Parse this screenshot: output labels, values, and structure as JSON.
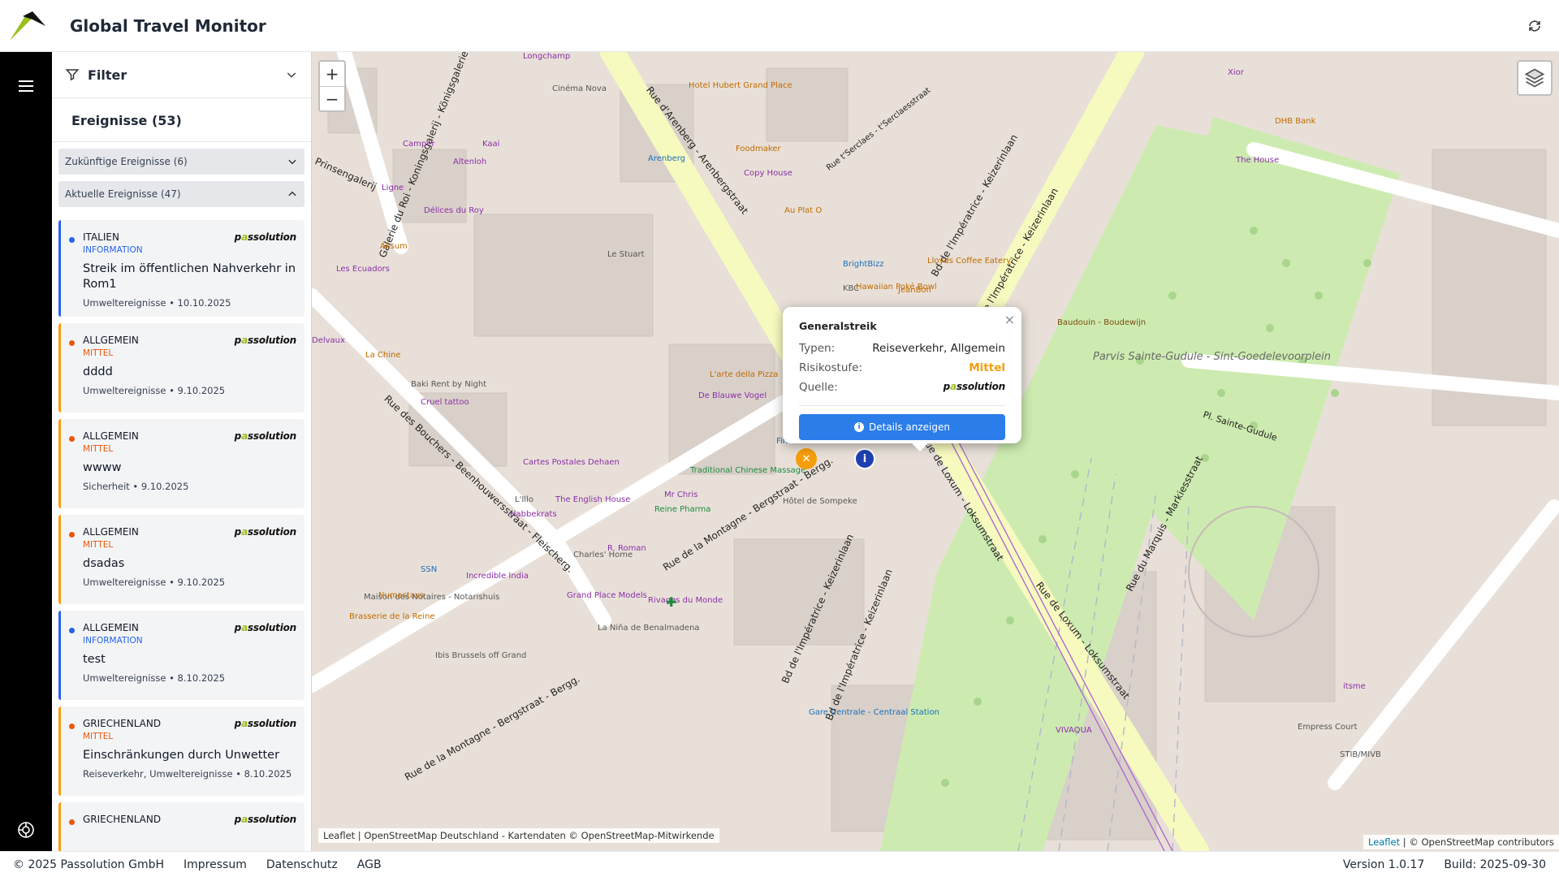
{
  "app": {
    "title": "Global Travel Monitor"
  },
  "sidebar": {
    "filter_label": "Filter",
    "events_title": "Ereignisse (53)",
    "groups": [
      {
        "label": "Zukünftige Ereignisse (6)",
        "expanded": false
      },
      {
        "label": "Aktuelle Ereignisse (47)",
        "expanded": true
      }
    ],
    "cards": [
      {
        "country": "ITALIEN",
        "level": "INFORMATION",
        "level_color": "#2563eb",
        "title": "Streik im öffentlichen Nahverkehr in Rom1",
        "meta": "Umweltereignisse • 10.10.2025",
        "bar_color": "#2563eb"
      },
      {
        "country": "ALLGEMEIN",
        "level": "MITTEL",
        "level_color": "#ea580c",
        "title": "dddd",
        "meta": "Umweltereignisse • 9.10.2025",
        "bar_color": "#f59e0b"
      },
      {
        "country": "ALLGEMEIN",
        "level": "MITTEL",
        "level_color": "#ea580c",
        "title": "wwww",
        "meta": "Sicherheit • 9.10.2025",
        "bar_color": "#f59e0b"
      },
      {
        "country": "ALLGEMEIN",
        "level": "MITTEL",
        "level_color": "#ea580c",
        "title": "dsadas",
        "meta": "Umweltereignisse • 9.10.2025",
        "bar_color": "#f59e0b"
      },
      {
        "country": "ALLGEMEIN",
        "level": "INFORMATION",
        "level_color": "#2563eb",
        "title": "test",
        "meta": "Umweltereignisse • 8.10.2025",
        "bar_color": "#2563eb"
      },
      {
        "country": "GRIECHENLAND",
        "level": "MITTEL",
        "level_color": "#ea580c",
        "title": "Einschränkungen durch Unwetter",
        "meta": "Reiseverkehr, Umweltereignisse • 8.10.2025",
        "bar_color": "#f59e0b"
      },
      {
        "country": "GRIECHENLAND",
        "level": "",
        "level_color": "#ea580c",
        "title": "",
        "meta": "",
        "bar_color": "#f59e0b"
      }
    ],
    "brand": {
      "prefix": "p",
      "accent": "a",
      "suffix": "ssolution"
    }
  },
  "map": {
    "zoom_in": "+",
    "zoom_out": "−",
    "attribution_left": "Leaflet | OpenStreetMap Deutschland - Kartendaten © OpenStreetMap-Mitwirkende",
    "attribution_right_link": "Leaflet",
    "attribution_right_text": " | © OpenStreetMap contributors",
    "labels": {
      "rue_arenberg": "Rue d'Arenberg - Arenbergstraat",
      "bd_imperatrice1": "Bd de l'Impératrice - Keizerinlaan",
      "bd_imperatrice2": "Bd de l'Impératrice - Keizerinlaan",
      "bd_imperatrice3": "Bd de l'Impératrice - Keizerinlaan",
      "bd_imperatrice4": "Bd de l'Impératrice - Keizerinlaan",
      "rue_montagne1": "Rue de la Montagne - Bergstraat - Bergg.",
      "rue_montagne2": "Rue de la Montagne - Bergstraat - Bergg.",
      "rue_bouchers": "Rue des Bouchers - Beenhouwersstraat - Fleischerg.",
      "rue_loxum1": "Rue de Loxum - Loksumstraat",
      "rue_loxum2": "Rue de Loxum - Loksumstraat",
      "rue_marquis": "Rue du Marquis - Markiesstraat",
      "galerie_roi": "Galerie du Roi - Koningsgalerij - Königsgalerie",
      "rue_sserclaes": "Rue t'Serclaes - t'Serclaesstraat",
      "parvis": "Parvis Sainte-Gudule - Sint-Goedelevoorplein",
      "le_stuart": "Le Stuart",
      "hotel_sompeke": "Hôtel de Sompeke",
      "maison_notaires": "Maison des Notaires - Notarishuis",
      "charles_home": "Charles' Home",
      "empress_court": "Empress Court",
      "cinema_nova": "Cinéma Nova",
      "hotel_hubert": "Hotel Hubert Grand Place",
      "foodmaker": "Foodmaker",
      "copy_house": "Copy House",
      "au_plat_o": "Au Plat O",
      "brightbizz": "BrightBizz",
      "kbc": "KBC",
      "hawaiian": "Hawaiian Poké Bowl",
      "jeanbon": "JeanBon",
      "lloyds": "Lloyds Coffee Eatery",
      "the_house": "The House",
      "dhb_bank": "DHB Bank",
      "xior": "Xior",
      "baudouin": "Baudouin - Boudewijn",
      "pl_sainte_gudule": "Pl. Sainte-Gudule",
      "arenberg": "Arenberg",
      "camper": "Camper",
      "kaai": "Kaai",
      "altenloh": "Altenloh",
      "ligne": "Ligne",
      "delices": "Délices du Roy",
      "aksum": "Aksum",
      "les_ecuadors": "Les Ecuadors",
      "delvaux": "Delvaux",
      "la_chine": "La Chine",
      "baki": "Baki Rent by Night",
      "cruel_tattoo": "Cruel tattoo",
      "cartes_postales": "Cartes Postales Dehaen",
      "english_house": "The English House",
      "lillo": "L'Illo",
      "habbekrats": "Habbekrats",
      "reine_pharma": "Reine Pharma",
      "mr_chris": "Mr Chris",
      "traditional": "Traditional Chinese Massage",
      "de_blauwe": "De Blauwe Vogel",
      "fintro": "Fintro",
      "r_roman": "R. Roman",
      "incredible": "Incredible India",
      "grand_place_models": "Grand Place Models",
      "rivages": "Rivages du Monde",
      "la_nina": "La Niña de Benalmadena",
      "numastays": "Numastays",
      "brasserie": "Brasserie de la Reine",
      "ssn": "SSN",
      "ibis": "Ibis Brussels off Grand",
      "gare_centrale": "Gare Centrale - Centraal Station",
      "vivaqua": "VIVAQUA",
      "stib": "STIB/MIVB",
      "itsme": "itsme",
      "longchamp": "Longchamp",
      "prinsengalerij": "- Prinsengalerij",
      "lette_della_pizza": "L'arte della Pizza"
    }
  },
  "popup": {
    "title": "Generalstreik",
    "rows": [
      {
        "key": "Typen:",
        "value": "Reiseverkehr, Allgemein"
      },
      {
        "key": "Risikostufe:",
        "value": "Mittel"
      },
      {
        "key": "Quelle:",
        "value": ""
      }
    ],
    "button": "Details anzeigen",
    "close": "×"
  },
  "footer": {
    "copyright": "© 2025 Passolution GmbH",
    "links": [
      "Impressum",
      "Datenschutz",
      "AGB"
    ],
    "version": "Version 1.0.17",
    "build": "Build: 2025-09-30"
  },
  "colors": {
    "accent_green": "#9bbf1c",
    "primary_blue": "#2b7de9",
    "mid_orange": "#f59e0b"
  }
}
